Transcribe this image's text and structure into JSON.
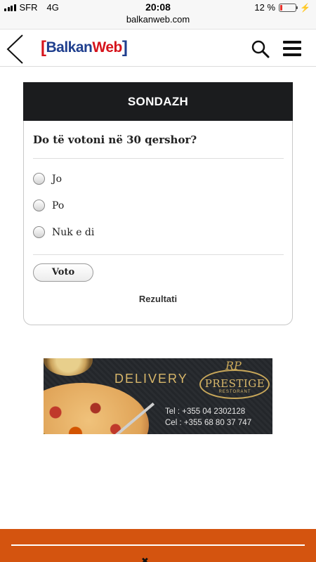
{
  "status_bar": {
    "carrier": "SFR",
    "network": "4G",
    "time": "20:08",
    "battery_text": "12 %",
    "battery_level": 0.12,
    "battery_color": "#e8312b"
  },
  "browser": {
    "url": "balkanweb.com"
  },
  "header": {
    "logo_part1": "Balkan",
    "logo_part2": "Web",
    "logo_colors": {
      "blue": "#1f3f8e",
      "red": "#d6141c"
    },
    "icons": [
      "back-arrow-icon",
      "search-icon",
      "hamburger-menu-icon"
    ]
  },
  "poll": {
    "title": "SONDAZH",
    "question": "Do të votoni në 30 qershor?",
    "options": [
      {
        "label": "Jo",
        "selected": false
      },
      {
        "label": "Po",
        "selected": false
      },
      {
        "label": "Nuk e di",
        "selected": false
      }
    ],
    "vote_label": "Voto",
    "results_label": "Rezultati"
  },
  "ad": {
    "delivery": "DELIVERY",
    "monogram": "RP",
    "brand": "PRESTIGE",
    "brand_sub": "RESTORANT",
    "phone_tel": "Tel : +355 04 2302128",
    "phone_cel": "Cel : +355 68 80 37 747"
  },
  "footer": {
    "accent": "#d4540f"
  }
}
